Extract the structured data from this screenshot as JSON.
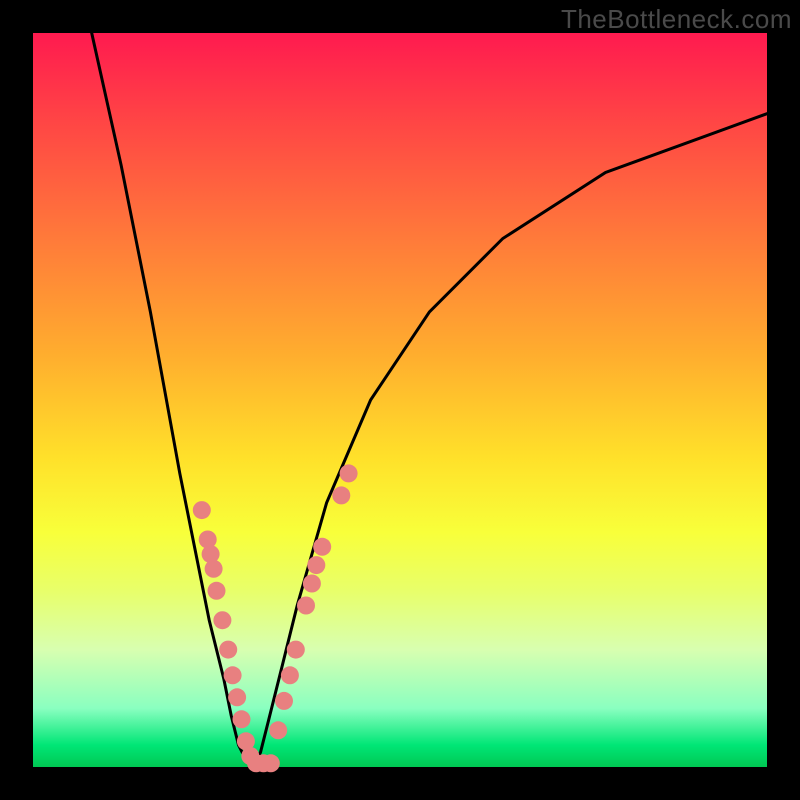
{
  "watermark": "TheBottleneck.com",
  "chart_data": {
    "type": "line",
    "title": "",
    "xlabel": "",
    "ylabel": "",
    "xlim": [
      0,
      100
    ],
    "ylim": [
      0,
      100
    ],
    "series": [
      {
        "name": "left-curve",
        "x": [
          8,
          12,
          16,
          20,
          22,
          24,
          26,
          27,
          28,
          29,
          30
        ],
        "y": [
          100,
          82,
          62,
          40,
          30,
          20,
          12,
          7,
          3,
          1,
          0
        ]
      },
      {
        "name": "right-curve",
        "x": [
          30,
          31,
          32,
          34,
          36,
          40,
          46,
          54,
          64,
          78,
          100
        ],
        "y": [
          0,
          2,
          6,
          14,
          22,
          36,
          50,
          62,
          72,
          81,
          89
        ]
      }
    ],
    "dot_clusters": [
      {
        "name": "left-cluster",
        "points": [
          [
            23.0,
            35.0
          ],
          [
            23.8,
            31.0
          ],
          [
            24.2,
            29.0
          ],
          [
            24.6,
            27.0
          ],
          [
            25.0,
            24.0
          ],
          [
            25.8,
            20.0
          ],
          [
            26.6,
            16.0
          ],
          [
            27.2,
            12.5
          ],
          [
            27.8,
            9.5
          ],
          [
            28.4,
            6.5
          ],
          [
            29.0,
            3.5
          ],
          [
            29.6,
            1.5
          ],
          [
            30.4,
            0.5
          ],
          [
            31.4,
            0.5
          ],
          [
            32.4,
            0.5
          ]
        ]
      },
      {
        "name": "right-cluster",
        "points": [
          [
            33.4,
            5.0
          ],
          [
            34.2,
            9.0
          ],
          [
            35.0,
            12.5
          ],
          [
            35.8,
            16.0
          ],
          [
            37.2,
            22.0
          ],
          [
            38.0,
            25.0
          ],
          [
            38.6,
            27.5
          ],
          [
            39.4,
            30.0
          ],
          [
            42.0,
            37.0
          ],
          [
            43.0,
            40.0
          ]
        ]
      }
    ],
    "gradient_bands": [
      {
        "stop": 0.0,
        "color": "#ff1a4f"
      },
      {
        "stop": 0.12,
        "color": "#ff4545"
      },
      {
        "stop": 0.28,
        "color": "#ff7a3a"
      },
      {
        "stop": 0.44,
        "color": "#ffae2e"
      },
      {
        "stop": 0.58,
        "color": "#ffe12a"
      },
      {
        "stop": 0.68,
        "color": "#f8ff3a"
      },
      {
        "stop": 0.76,
        "color": "#e8ff6a"
      },
      {
        "stop": 0.84,
        "color": "#d8ffb0"
      },
      {
        "stop": 0.92,
        "color": "#8affc0"
      },
      {
        "stop": 0.97,
        "color": "#00e676"
      },
      {
        "stop": 1.0,
        "color": "#00c853"
      }
    ],
    "dot_color": "#e88080",
    "curve_color": "#000000"
  }
}
